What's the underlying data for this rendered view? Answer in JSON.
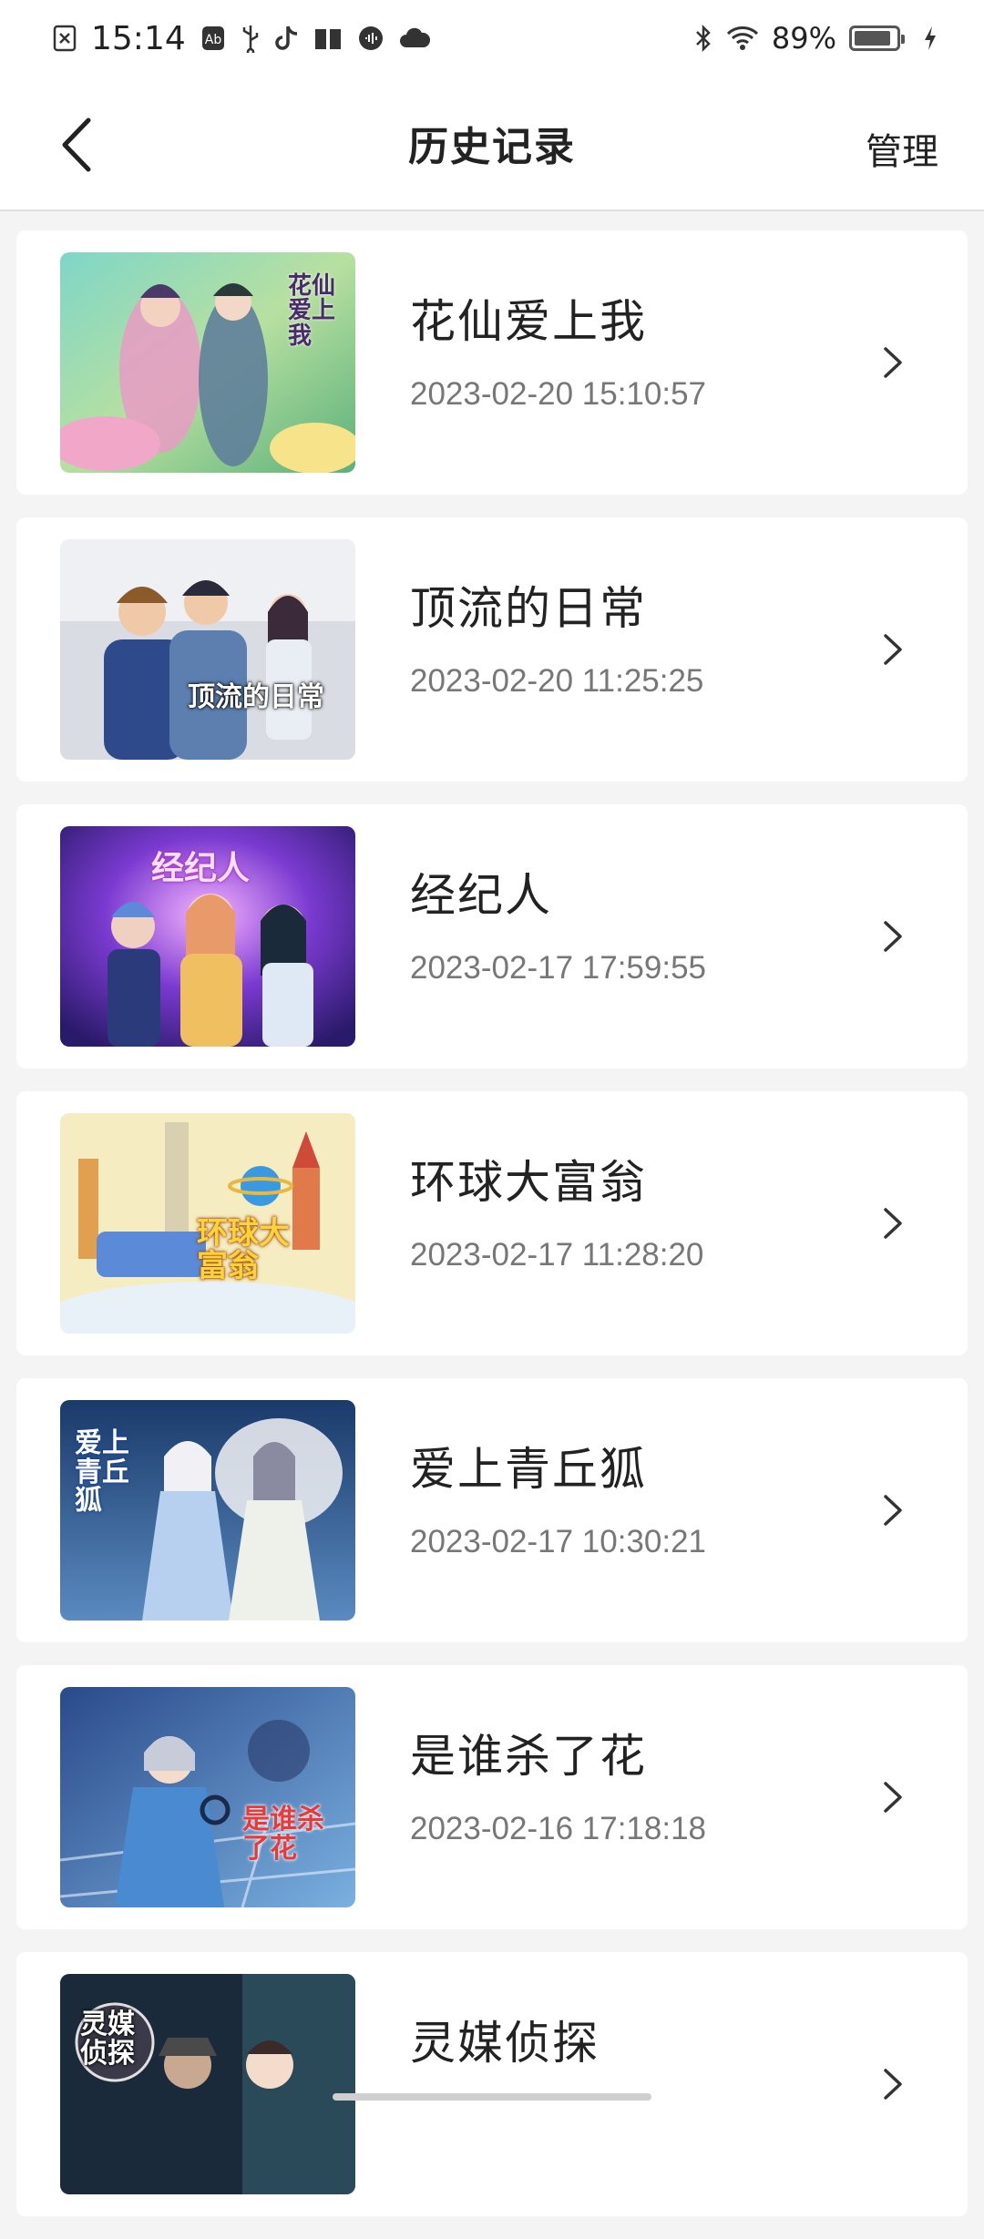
{
  "status": {
    "time": "15:14",
    "battery": "89%",
    "battery_level": 0.89
  },
  "header": {
    "title": "历史记录",
    "manage_label": "管理"
  },
  "items": [
    {
      "title": "花仙爱上我",
      "time": "2023-02-20 15:10:57",
      "cover_text": "花仙爱上我"
    },
    {
      "title": "顶流的日常",
      "time": "2023-02-20 11:25:25",
      "cover_text": "顶流的日常"
    },
    {
      "title": "经纪人",
      "time": "2023-02-17 17:59:55",
      "cover_text": "经纪人"
    },
    {
      "title": "环球大富翁",
      "time": "2023-02-17 11:28:20",
      "cover_text": "环球大富翁"
    },
    {
      "title": "爱上青丘狐",
      "time": "2023-02-17 10:30:21",
      "cover_text": "爱上青丘狐"
    },
    {
      "title": "是谁杀了花",
      "time": "2023-02-16 17:18:18",
      "cover_text": "是谁杀了花"
    },
    {
      "title": "灵媒侦探",
      "time": "",
      "cover_text": "灵媒侦探"
    }
  ]
}
